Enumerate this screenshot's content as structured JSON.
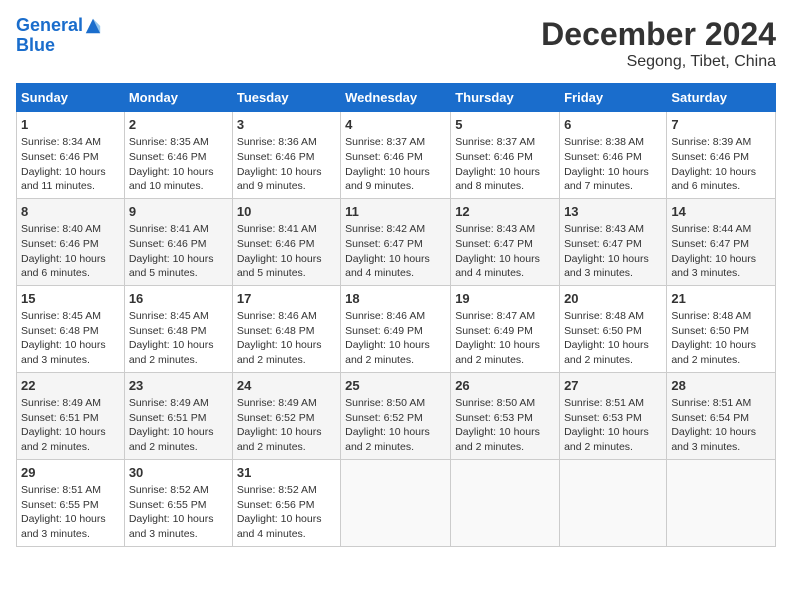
{
  "header": {
    "logo_line1": "General",
    "logo_line2": "Blue",
    "title": "December 2024",
    "subtitle": "Segong, Tibet, China"
  },
  "days_of_week": [
    "Sunday",
    "Monday",
    "Tuesday",
    "Wednesday",
    "Thursday",
    "Friday",
    "Saturday"
  ],
  "weeks": [
    [
      {
        "day": "1",
        "sunrise": "8:34 AM",
        "sunset": "6:46 PM",
        "daylight": "10 hours and 11 minutes."
      },
      {
        "day": "2",
        "sunrise": "8:35 AM",
        "sunset": "6:46 PM",
        "daylight": "10 hours and 10 minutes."
      },
      {
        "day": "3",
        "sunrise": "8:36 AM",
        "sunset": "6:46 PM",
        "daylight": "10 hours and 9 minutes."
      },
      {
        "day": "4",
        "sunrise": "8:37 AM",
        "sunset": "6:46 PM",
        "daylight": "10 hours and 9 minutes."
      },
      {
        "day": "5",
        "sunrise": "8:37 AM",
        "sunset": "6:46 PM",
        "daylight": "10 hours and 8 minutes."
      },
      {
        "day": "6",
        "sunrise": "8:38 AM",
        "sunset": "6:46 PM",
        "daylight": "10 hours and 7 minutes."
      },
      {
        "day": "7",
        "sunrise": "8:39 AM",
        "sunset": "6:46 PM",
        "daylight": "10 hours and 6 minutes."
      }
    ],
    [
      {
        "day": "8",
        "sunrise": "8:40 AM",
        "sunset": "6:46 PM",
        "daylight": "10 hours and 6 minutes."
      },
      {
        "day": "9",
        "sunrise": "8:41 AM",
        "sunset": "6:46 PM",
        "daylight": "10 hours and 5 minutes."
      },
      {
        "day": "10",
        "sunrise": "8:41 AM",
        "sunset": "6:46 PM",
        "daylight": "10 hours and 5 minutes."
      },
      {
        "day": "11",
        "sunrise": "8:42 AM",
        "sunset": "6:47 PM",
        "daylight": "10 hours and 4 minutes."
      },
      {
        "day": "12",
        "sunrise": "8:43 AM",
        "sunset": "6:47 PM",
        "daylight": "10 hours and 4 minutes."
      },
      {
        "day": "13",
        "sunrise": "8:43 AM",
        "sunset": "6:47 PM",
        "daylight": "10 hours and 3 minutes."
      },
      {
        "day": "14",
        "sunrise": "8:44 AM",
        "sunset": "6:47 PM",
        "daylight": "10 hours and 3 minutes."
      }
    ],
    [
      {
        "day": "15",
        "sunrise": "8:45 AM",
        "sunset": "6:48 PM",
        "daylight": "10 hours and 3 minutes."
      },
      {
        "day": "16",
        "sunrise": "8:45 AM",
        "sunset": "6:48 PM",
        "daylight": "10 hours and 2 minutes."
      },
      {
        "day": "17",
        "sunrise": "8:46 AM",
        "sunset": "6:48 PM",
        "daylight": "10 hours and 2 minutes."
      },
      {
        "day": "18",
        "sunrise": "8:46 AM",
        "sunset": "6:49 PM",
        "daylight": "10 hours and 2 minutes."
      },
      {
        "day": "19",
        "sunrise": "8:47 AM",
        "sunset": "6:49 PM",
        "daylight": "10 hours and 2 minutes."
      },
      {
        "day": "20",
        "sunrise": "8:48 AM",
        "sunset": "6:50 PM",
        "daylight": "10 hours and 2 minutes."
      },
      {
        "day": "21",
        "sunrise": "8:48 AM",
        "sunset": "6:50 PM",
        "daylight": "10 hours and 2 minutes."
      }
    ],
    [
      {
        "day": "22",
        "sunrise": "8:49 AM",
        "sunset": "6:51 PM",
        "daylight": "10 hours and 2 minutes."
      },
      {
        "day": "23",
        "sunrise": "8:49 AM",
        "sunset": "6:51 PM",
        "daylight": "10 hours and 2 minutes."
      },
      {
        "day": "24",
        "sunrise": "8:49 AM",
        "sunset": "6:52 PM",
        "daylight": "10 hours and 2 minutes."
      },
      {
        "day": "25",
        "sunrise": "8:50 AM",
        "sunset": "6:52 PM",
        "daylight": "10 hours and 2 minutes."
      },
      {
        "day": "26",
        "sunrise": "8:50 AM",
        "sunset": "6:53 PM",
        "daylight": "10 hours and 2 minutes."
      },
      {
        "day": "27",
        "sunrise": "8:51 AM",
        "sunset": "6:53 PM",
        "daylight": "10 hours and 2 minutes."
      },
      {
        "day": "28",
        "sunrise": "8:51 AM",
        "sunset": "6:54 PM",
        "daylight": "10 hours and 3 minutes."
      }
    ],
    [
      {
        "day": "29",
        "sunrise": "8:51 AM",
        "sunset": "6:55 PM",
        "daylight": "10 hours and 3 minutes."
      },
      {
        "day": "30",
        "sunrise": "8:52 AM",
        "sunset": "6:55 PM",
        "daylight": "10 hours and 3 minutes."
      },
      {
        "day": "31",
        "sunrise": "8:52 AM",
        "sunset": "6:56 PM",
        "daylight": "10 hours and 4 minutes."
      },
      null,
      null,
      null,
      null
    ]
  ]
}
